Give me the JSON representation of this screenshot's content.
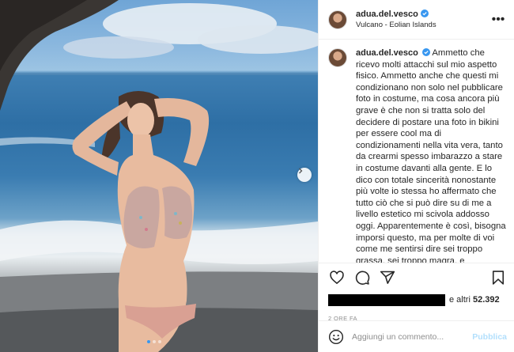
{
  "post": {
    "username": "adua.del.vesco",
    "location": "Vulcano - Eolian Islands",
    "caption_text": "Ammetto che ricevo molti attacchi sul mio aspetto fisico. Ammetto anche che questi mi condizionano non solo nel pubblicare foto in costume, ma cosa ancora più grave è che non si tratta solo del decidere di postare una foto in bikini per essere cool ma di condizionamenti nella vita vera, tanto da crearmi spesso imbarazzo a stare in costume davanti alla gente. E lo dico con totale sincerità nonostante più volte io stessa ho affermato che tutto ciò che si può dire su di me a livello estetico mi scivola addosso oggi. Apparentemente è così, bisogna imporsi questo, ma per molte di voi come me sentirsi dire sei troppo grassa, sei troppo magra, e",
    "likes_prefix": "e altri",
    "likes_count": "52.392",
    "timestamp": "2 ORE FA",
    "comment_placeholder": "Aggiungi un commento...",
    "publish_label": "Pubblica",
    "more_label": "•••"
  },
  "carousel": {
    "total_slides": 3,
    "active_slide": 1
  },
  "icons": {
    "verified": "verified-badge-icon",
    "like": "heart-icon",
    "comment": "comment-bubble-icon",
    "share": "paper-plane-icon",
    "save": "bookmark-icon",
    "emoji": "smiley-icon",
    "next": "chevron-right-icon"
  },
  "colors": {
    "verified_blue": "#3897f0",
    "publish_disabled": "#b2dffc",
    "secondary_text": "#8e8e8e"
  }
}
